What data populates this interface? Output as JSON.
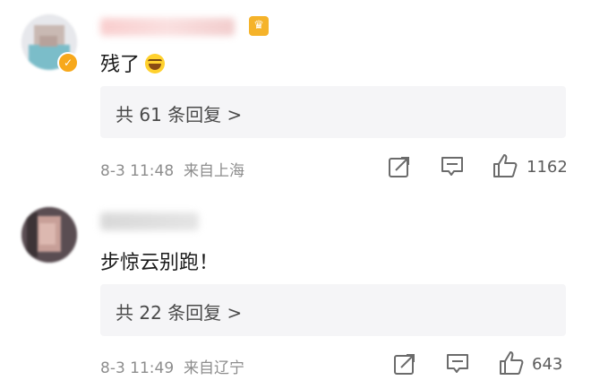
{
  "colors": {
    "accent_badge": "#f5b32a",
    "verified": "#f7a81b",
    "reply_box_bg": "#f5f5f7",
    "meta_text": "#8d8d8d"
  },
  "comments": [
    {
      "text": "残了",
      "emoji": "laughing-crying-emoji",
      "replies_label": "共 61 条回复 >",
      "meta": "8-3 11:48  来自上海",
      "likes": "1162"
    },
    {
      "text": "步惊云别跑！",
      "replies_label": "共 22 条回复 >",
      "meta": "8-3 11:49  来自辽宁",
      "likes": "643"
    }
  ]
}
